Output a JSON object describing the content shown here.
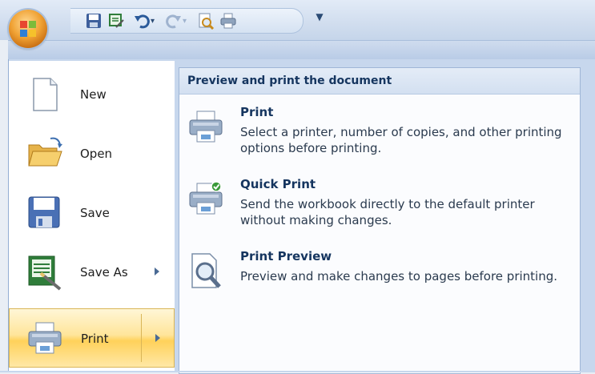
{
  "quick_access_toolbar": {
    "buttons": [
      {
        "icon": "save-icon"
      },
      {
        "icon": "print-preview-save-icon"
      },
      {
        "icon": "undo-icon"
      },
      {
        "icon": "redo-icon"
      },
      {
        "icon": "print-preview-icon"
      },
      {
        "icon": "quick-print-icon"
      }
    ],
    "customize_label": "↓"
  },
  "left_menu": {
    "items": [
      {
        "label": "New",
        "icon": "new-document-icon",
        "submenu": false
      },
      {
        "label": "Open",
        "icon": "open-folder-icon",
        "submenu": false
      },
      {
        "label": "Save",
        "icon": "save-icon",
        "submenu": false
      },
      {
        "label": "Save As",
        "icon": "save-as-icon",
        "submenu": true
      },
      {
        "label": "Print",
        "icon": "printer-icon",
        "submenu": true,
        "active": true
      }
    ]
  },
  "submenu": {
    "header": "Preview and print the document",
    "options": [
      {
        "title": "Print",
        "description": "Select a printer, number of copies, and other printing options before printing.",
        "icon": "printer-icon"
      },
      {
        "title": "Quick Print",
        "description": "Send the workbook directly to the default printer without making changes.",
        "icon": "quick-print-icon"
      },
      {
        "title": "Print Preview",
        "description": "Preview and make changes to pages before printing.",
        "icon": "print-preview-icon"
      }
    ]
  },
  "colors": {
    "accent": "#15355f",
    "active_highlight": "#ffd15a",
    "menu_frame": "#c7d7ed"
  }
}
